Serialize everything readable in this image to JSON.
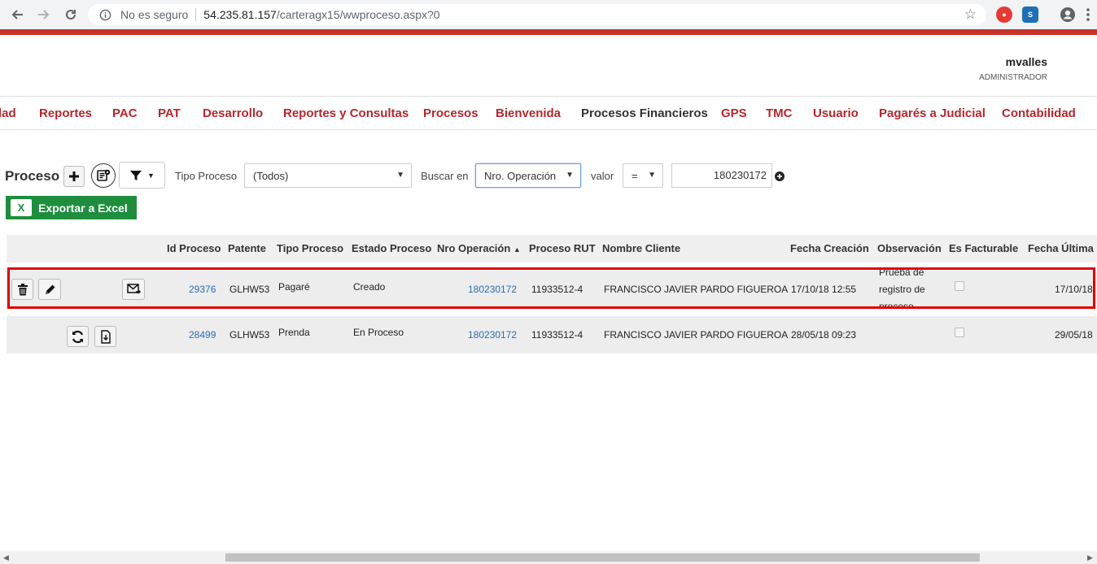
{
  "browser": {
    "secure_label": "No es seguro",
    "url_host": "54.235.81.157",
    "url_path": "/carteragx15/wwproceso.aspx?0"
  },
  "user": {
    "name": "mvalles",
    "role": "ADMINISTRADOR"
  },
  "menu": [
    {
      "label": "lad"
    },
    {
      "label": "Reportes"
    },
    {
      "label": "PAC"
    },
    {
      "label": "PAT"
    },
    {
      "label": "Desarrollo"
    },
    {
      "label": "Reportes y Consultas"
    },
    {
      "label": "Procesos"
    },
    {
      "label": "Bienvenida"
    },
    {
      "label": "Procesos Financieros"
    },
    {
      "label": "GPS"
    },
    {
      "label": "TMC"
    },
    {
      "label": "Usuario"
    },
    {
      "label": "Pagarés a Judicial"
    },
    {
      "label": "Contabilidad"
    }
  ],
  "toolbar": {
    "title": "Proceso",
    "tipo_label": "Tipo Proceso",
    "tipo_value": "(Todos)",
    "buscar_label": "Buscar en",
    "buscar_value": "Nro. Operación",
    "valor_label": "valor",
    "operator_value": "=",
    "search_value": "180230172",
    "export_label": "Exportar a Excel"
  },
  "grid": {
    "columns": [
      "Id Proceso",
      "Patente",
      "Tipo Proceso",
      "Estado Proceso",
      "Nro Operación",
      "Proceso RUT",
      "Nombre Cliente",
      "Fecha Creación",
      "Observación",
      "Es Facturable",
      "Fecha Última"
    ],
    "sort_indicator": "▲",
    "rows": [
      {
        "id": "29376",
        "patente": "GLHW53",
        "tipo": "Pagaré",
        "estado": "Creado",
        "operacion": "180230172",
        "rut": "11933512-4",
        "cliente": "FRANCISCO JAVIER PARDO FIGUEROA",
        "fecha": "17/10/18 12:55",
        "obs_1": "Prueba de",
        "obs_2": "registro de",
        "obs_3": "proceso",
        "facturable": false,
        "ultima": "17/10/18"
      },
      {
        "id": "28499",
        "patente": "GLHW53",
        "tipo": "Prenda",
        "estado": "En Proceso",
        "operacion": "180230172",
        "rut": "11933512-4",
        "cliente": "FRANCISCO JAVIER PARDO FIGUEROA",
        "fecha": "28/05/18 09:23",
        "obs_1": "",
        "obs_2": "",
        "obs_3": "",
        "facturable": false,
        "ultima": "29/05/18"
      }
    ]
  },
  "colors": {
    "brand_red": "#c9302c",
    "menu_red": "#b5272d",
    "excel_green": "#1e8e3e",
    "link_blue": "#2a6db5",
    "highlight": "#e00000"
  }
}
